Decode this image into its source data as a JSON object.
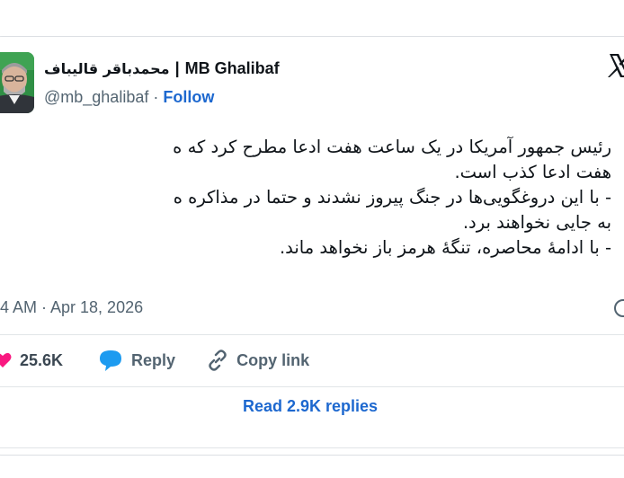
{
  "author": {
    "name_fa": "محمدباقر قالیباف",
    "separator": "|",
    "name_en": "MB Ghalibaf",
    "handle": "@mb_ghalibaf",
    "follow_label": "Follow"
  },
  "tweet": {
    "lines": [
      "رئیس جمهور آمریکا در یک ساعت هفت ادعا مطرح کرد که ه",
      "هفت ادعا کذب است.",
      "- با این دروغگویی‌ها در جنگ پیروز نشدند و حتما در مذاکره ه",
      "به جایی نخواهند برد.",
      "- با ادامهٔ محاصره، تنگهٔ هرمز باز نخواهد ماند."
    ],
    "timestamp": "4 AM · Apr 18, 2026"
  },
  "actions": {
    "likes_count": "25.6K",
    "reply_label": "Reply",
    "copy_link_label": "Copy link"
  },
  "read_replies_label": "Read 2.9K replies",
  "colors": {
    "accent": "#1d68cf",
    "like": "#f91880",
    "reply_bubble": "#1d9bf0",
    "muted": "#536471"
  },
  "icons": {
    "platform": "x-logo-icon",
    "like": "heart-icon",
    "reply": "speech-bubble-icon",
    "copy": "link-icon",
    "info": "info-icon"
  }
}
